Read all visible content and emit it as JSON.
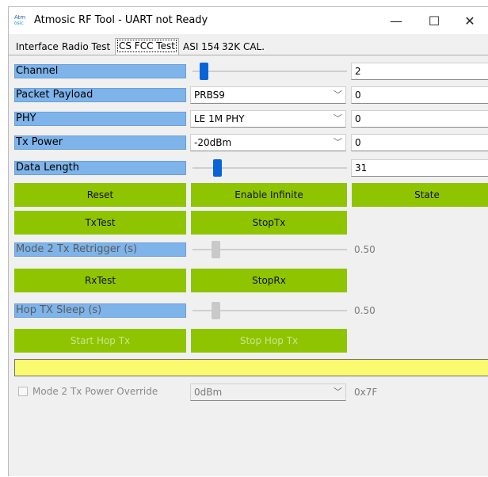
{
  "window": {
    "title": "Atmosic RF Tool - UART not Ready",
    "icon_line1": "Atm",
    "icon_line2": "osic",
    "controls": {
      "minimize": "—",
      "maximize": "☐",
      "close": "✕"
    }
  },
  "tabs": [
    {
      "label": "Interface",
      "active": false
    },
    {
      "label": "Radio Test",
      "active": false
    },
    {
      "label": "CS FCC Test",
      "active": true
    },
    {
      "label": "ASI 154",
      "active": false
    },
    {
      "label": "32K CAL.",
      "active": false
    }
  ],
  "rows": {
    "channel": {
      "label": "Channel",
      "value": "2",
      "slider_fraction": 0.05
    },
    "packet_payload": {
      "label": "Packet Payload",
      "selected": "PRBS9",
      "value": "0"
    },
    "phy": {
      "label": "PHY",
      "selected": "LE 1M PHY",
      "value": "0"
    },
    "tx_power": {
      "label": "Tx Power",
      "selected": "-20dBm",
      "value": "0"
    },
    "data_length": {
      "label": "Data Length",
      "value": "31",
      "slider_fraction": 0.14
    },
    "mode2_retrigger": {
      "label": "Mode 2 Tx Retrigger (s)",
      "value": "0.50",
      "slider_fraction": 0.13
    },
    "hop_sleep": {
      "label": "Hop TX Sleep (s)",
      "value": "0.50",
      "slider_fraction": 0.13
    }
  },
  "buttons": {
    "reset": "Reset",
    "enable_infinite": "Enable Infinite",
    "state": "State",
    "txtest": "TxTest",
    "stoptx": "StopTx",
    "rxtest": "RxTest",
    "stoprx": "StopRx",
    "start_hop": "Start Hop Tx",
    "stop_hop": "Stop Hop Tx"
  },
  "override": {
    "checkbox_label": "Mode 2 Tx Power Override",
    "selected": "0dBm",
    "value": "0x7F"
  },
  "colors": {
    "button_green": "#8fc400",
    "label_blue": "#7eb4ea",
    "slider_blue": "#0a64d8",
    "progress_yellow": "#fafa6e"
  }
}
